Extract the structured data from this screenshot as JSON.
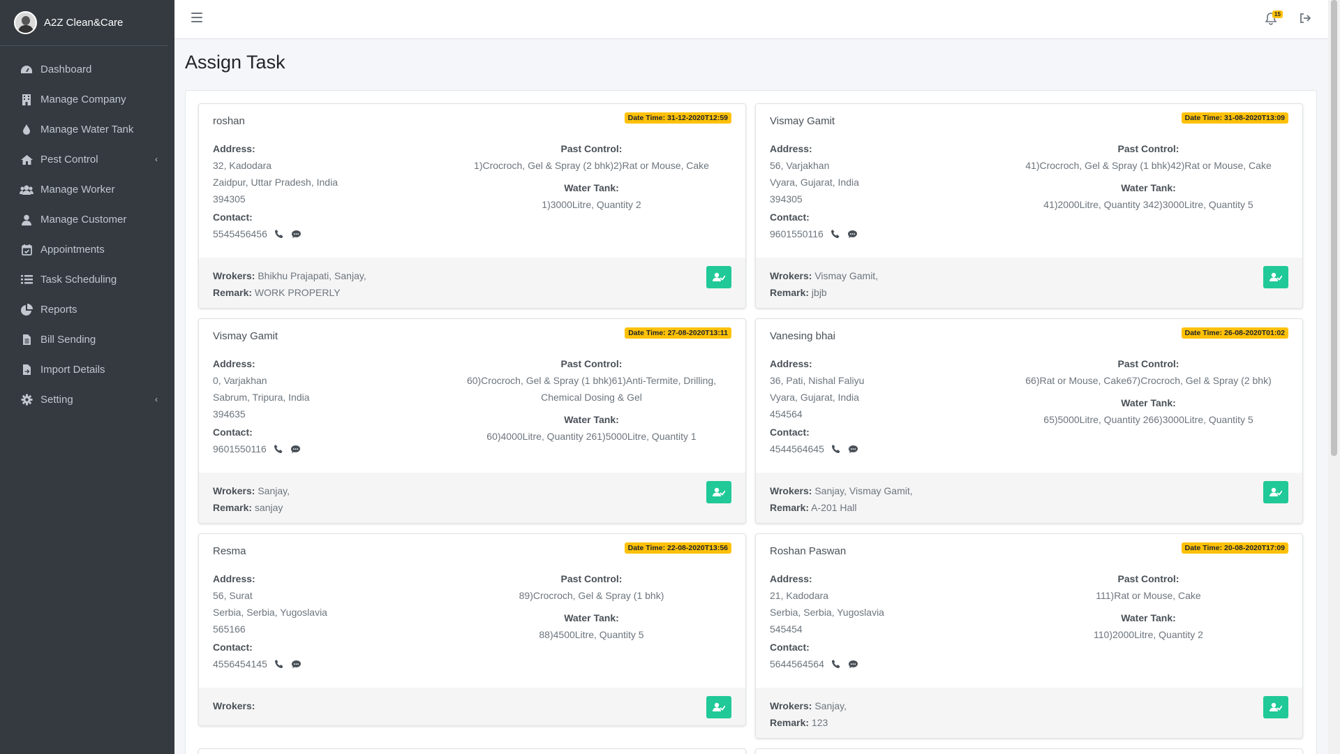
{
  "brand": {
    "name": "A2Z Clean&Care"
  },
  "sidebar": {
    "items": [
      {
        "label": "Dashboard",
        "icon": "dashboard-icon"
      },
      {
        "label": "Manage Company",
        "icon": "building-icon"
      },
      {
        "label": "Manage Water Tank",
        "icon": "water-drop-icon"
      },
      {
        "label": "Pest Control",
        "icon": "home-icon",
        "caret": "‹"
      },
      {
        "label": "Manage Worker",
        "icon": "users-icon"
      },
      {
        "label": "Manage Customer",
        "icon": "user-icon"
      },
      {
        "label": "Appointments",
        "icon": "calendar-check-icon"
      },
      {
        "label": "Task Scheduling",
        "icon": "list-icon"
      },
      {
        "label": "Reports",
        "icon": "pie-chart-icon"
      },
      {
        "label": "Bill Sending",
        "icon": "file-icon"
      },
      {
        "label": "Import Details",
        "icon": "file-import-icon"
      },
      {
        "label": "Setting",
        "icon": "gear-icon",
        "caret": "‹"
      }
    ]
  },
  "topbar": {
    "notification_count": "15"
  },
  "page": {
    "title": "Assign Task"
  },
  "labels": {
    "address": "Address:",
    "contact": "Contact:",
    "past_control": "Past Control:",
    "water_tank": "Water Tank:",
    "workers": "Wrokers:",
    "remark": "Remark:"
  },
  "colors": {
    "sidebar": "#343a40",
    "badge": "#ffc107",
    "assign_button": "#20c997"
  },
  "tasks": [
    {
      "name": "roshan",
      "datetime": "Date Time: 31-12-2020T12:59",
      "address1": "32, Kadodara",
      "address2": "Zaidpur, Uttar Pradesh, India",
      "pincode": "394305",
      "contact": "5545456456",
      "past_control": "1)Crocroch, Gel & Spray (2 bhk)2)Rat or Mouse, Cake",
      "water_tank": "1)3000Litre, Quantity 2",
      "workers": "Bhikhu Prajapati, Sanjay,",
      "remark": "WORK PROPERLY"
    },
    {
      "name": "Vismay Gamit",
      "datetime": "Date Time: 31-08-2020T13:09",
      "address1": "56, Varjakhan",
      "address2": "Vyara, Gujarat, India",
      "pincode": "394305",
      "contact": "9601550116",
      "past_control": "41)Crocroch, Gel & Spray (1 bhk)42)Rat or Mouse, Cake",
      "water_tank": "41)2000Litre, Quantity 342)3000Litre, Quantity 5",
      "workers": "Vismay Gamit,",
      "remark": "jbjb"
    },
    {
      "name": "Vismay Gamit",
      "datetime": "Date Time: 27-08-2020T13:11",
      "address1": "0, Varjakhan",
      "address2": "Sabrum, Tripura, India",
      "pincode": "394635",
      "contact": "9601550116",
      "past_control": "60)Crocroch, Gel & Spray (1 bhk)61)Anti-Termite, Drilling, Chemical Dosing & Gel",
      "water_tank": "60)4000Litre, Quantity 261)5000Litre, Quantity 1",
      "workers": "Sanjay,",
      "remark": "sanjay"
    },
    {
      "name": "Vanesing bhai",
      "datetime": "Date Time: 26-08-2020T01:02",
      "address1": "36, Pati, Nishal Faliyu",
      "address2": "Vyara, Gujarat, India",
      "pincode": "454564",
      "contact": "4544564645",
      "past_control": "66)Rat or Mouse, Cake67)Crocroch, Gel & Spray (2 bhk)",
      "water_tank": "65)5000Litre, Quantity 266)3000Litre, Quantity 5",
      "workers": "Sanjay, Vismay Gamit,",
      "remark": "A-201 Hall"
    },
    {
      "name": "Resma",
      "datetime": "Date Time: 22-08-2020T13:56",
      "address1": "56, Surat",
      "address2": "Serbia, Serbia, Yugoslavia",
      "pincode": "565166",
      "contact": "4556454145",
      "past_control": "89)Crocroch, Gel & Spray (1 bhk)",
      "water_tank": "88)4500Litre, Quantity 5",
      "workers": "",
      "remark": ""
    },
    {
      "name": "Roshan Paswan",
      "datetime": "Date Time: 20-08-2020T17:09",
      "address1": "21, Kadodara",
      "address2": "Serbia, Serbia, Yugoslavia",
      "pincode": "545454",
      "contact": "5644564564",
      "past_control": "111)Rat or Mouse, Cake",
      "water_tank": "110)2000Litre, Quantity 2",
      "workers": "Sanjay,",
      "remark": "123"
    }
  ]
}
